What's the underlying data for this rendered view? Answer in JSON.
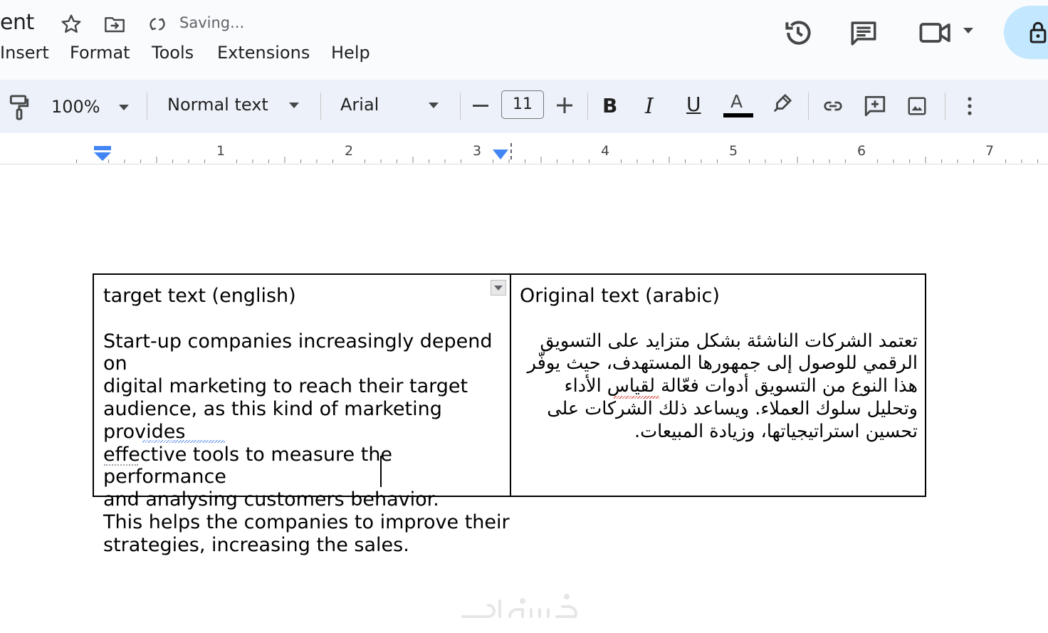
{
  "header": {
    "doc_title_fragment": "ent",
    "saving_status": "Saving...",
    "menu": [
      "Insert",
      "Format",
      "Tools",
      "Extensions",
      "Help"
    ]
  },
  "toolbar": {
    "zoom": "100%",
    "style": "Normal text",
    "font": "Arial",
    "font_size": "11",
    "bold_label": "B",
    "italic_label": "I",
    "underline_label": "U",
    "text_color_label": "A",
    "text_color": "#000000"
  },
  "ruler": {
    "numbers": [
      "1",
      "2",
      "3",
      "4",
      "5",
      "6",
      "7"
    ]
  },
  "document": {
    "table": {
      "left_heading": "target text (english)",
      "left_body": "Start-up companies increasingly depend on\ndigital marketing to reach their target\naudience, as this kind of marketing provides\neffective tools to measure the performance\nand analysing customers behavior.\nThis helps the companies to improve their\nstrategies, increasing the sales.",
      "right_heading": "Original text (arabic)",
      "right_body": "تعتمد الشركات الناشئة بشكل متزايد على التسويق\nالرقمي للوصول إلى جمهورها المستهدف، حيث يوفّر\nهذا النوع من التسويق أدوات فعّالة لقياس الأداء\nوتحليل سلوك العملاء. ويساعد ذلك الشركات على\nتحسين استراتيجياتها، وزيادة المبيعات."
    }
  },
  "watermark": {
    "icon": "khamsat-logo-icon"
  },
  "colors": {
    "header_bg": "#f9fbfd",
    "toolbar_bg": "#edf2fa",
    "share_bg": "#c2e7ff",
    "ruler_marker": "#4285f4"
  }
}
